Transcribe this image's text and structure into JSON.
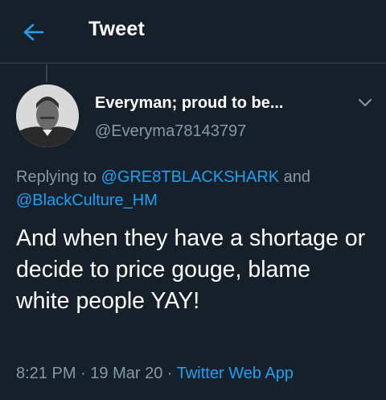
{
  "header": {
    "title": "Tweet",
    "back_icon": "arrow-left-icon"
  },
  "colors": {
    "background": "#15202b",
    "accent": "#1da1f2",
    "secondary_text": "#8899a6"
  },
  "tweet": {
    "display_name": "Everyman; proud to be...",
    "handle": "@Everyma78143797",
    "replying_prefix": "Replying to ",
    "mention_1": "@GRE8TBLACKSHARK",
    "replying_joiner": " and ",
    "mention_2": "@BlackCulture_HM",
    "text": "And when they have a shortage or decide to price gouge, blame white people YAY!",
    "time": "8:21 PM",
    "separator": " · ",
    "date": "19 Mar 20",
    "source": "Twitter Web App"
  }
}
